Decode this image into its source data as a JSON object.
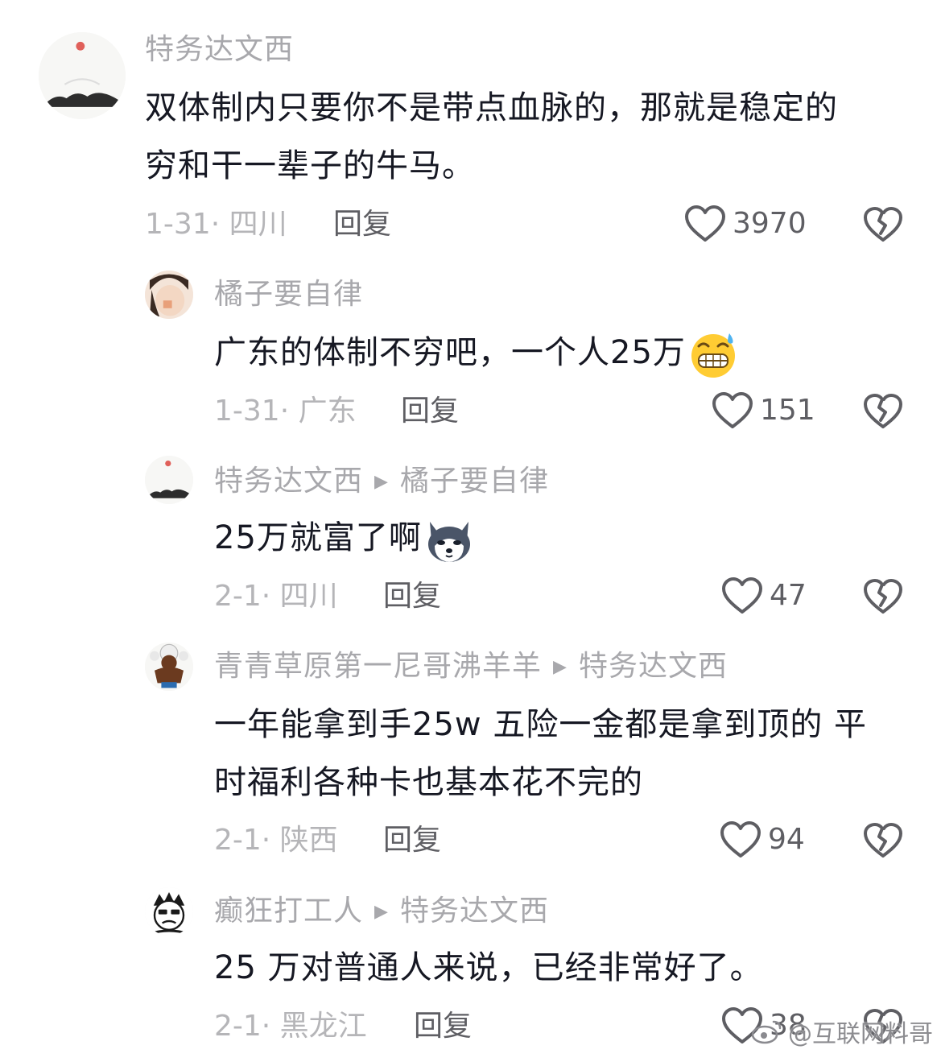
{
  "comments": [
    {
      "author": "特务达文西",
      "reply_to": "",
      "lines": [
        "双体制内只要你不是带点血脉的，那就是稳定的",
        "穷和干一辈子的牛马。"
      ],
      "date_location": "1-31· 四川",
      "reply_label": "回复",
      "likes": "3970"
    },
    {
      "author": "橘子要自律",
      "reply_to": "",
      "lines": [
        "广东的体制不穷吧，一个人25万"
      ],
      "date_location": "1-31· 广东",
      "reply_label": "回复",
      "likes": "151"
    },
    {
      "author": "特务达文西",
      "reply_to": "橘子要自律",
      "lines": [
        "25万就富了啊"
      ],
      "date_location": "2-1· 四川",
      "reply_label": "回复",
      "likes": "47"
    },
    {
      "author": "青青草原第一尼哥沸羊羊",
      "reply_to": "特务达文西",
      "lines": [
        "一年能拿到手25w 五险一金都是拿到顶的 平",
        "时福利各种卡也基本花不完的"
      ],
      "date_location": "2-1· 陕西",
      "reply_label": "回复",
      "likes": "94"
    },
    {
      "author": "癫狂打工人",
      "reply_to": "特务达文西",
      "lines": [
        "25 万对普通人来说，已经非常好了。"
      ],
      "date_location": "2-1· 黑龙江",
      "reply_label": "回复",
      "likes": "38"
    }
  ],
  "watermark": "@互联网料哥",
  "colors": {
    "name": "#a8a8ac",
    "text": "#161823",
    "date": "#b5b5b8",
    "reply": "#5e5e63"
  }
}
